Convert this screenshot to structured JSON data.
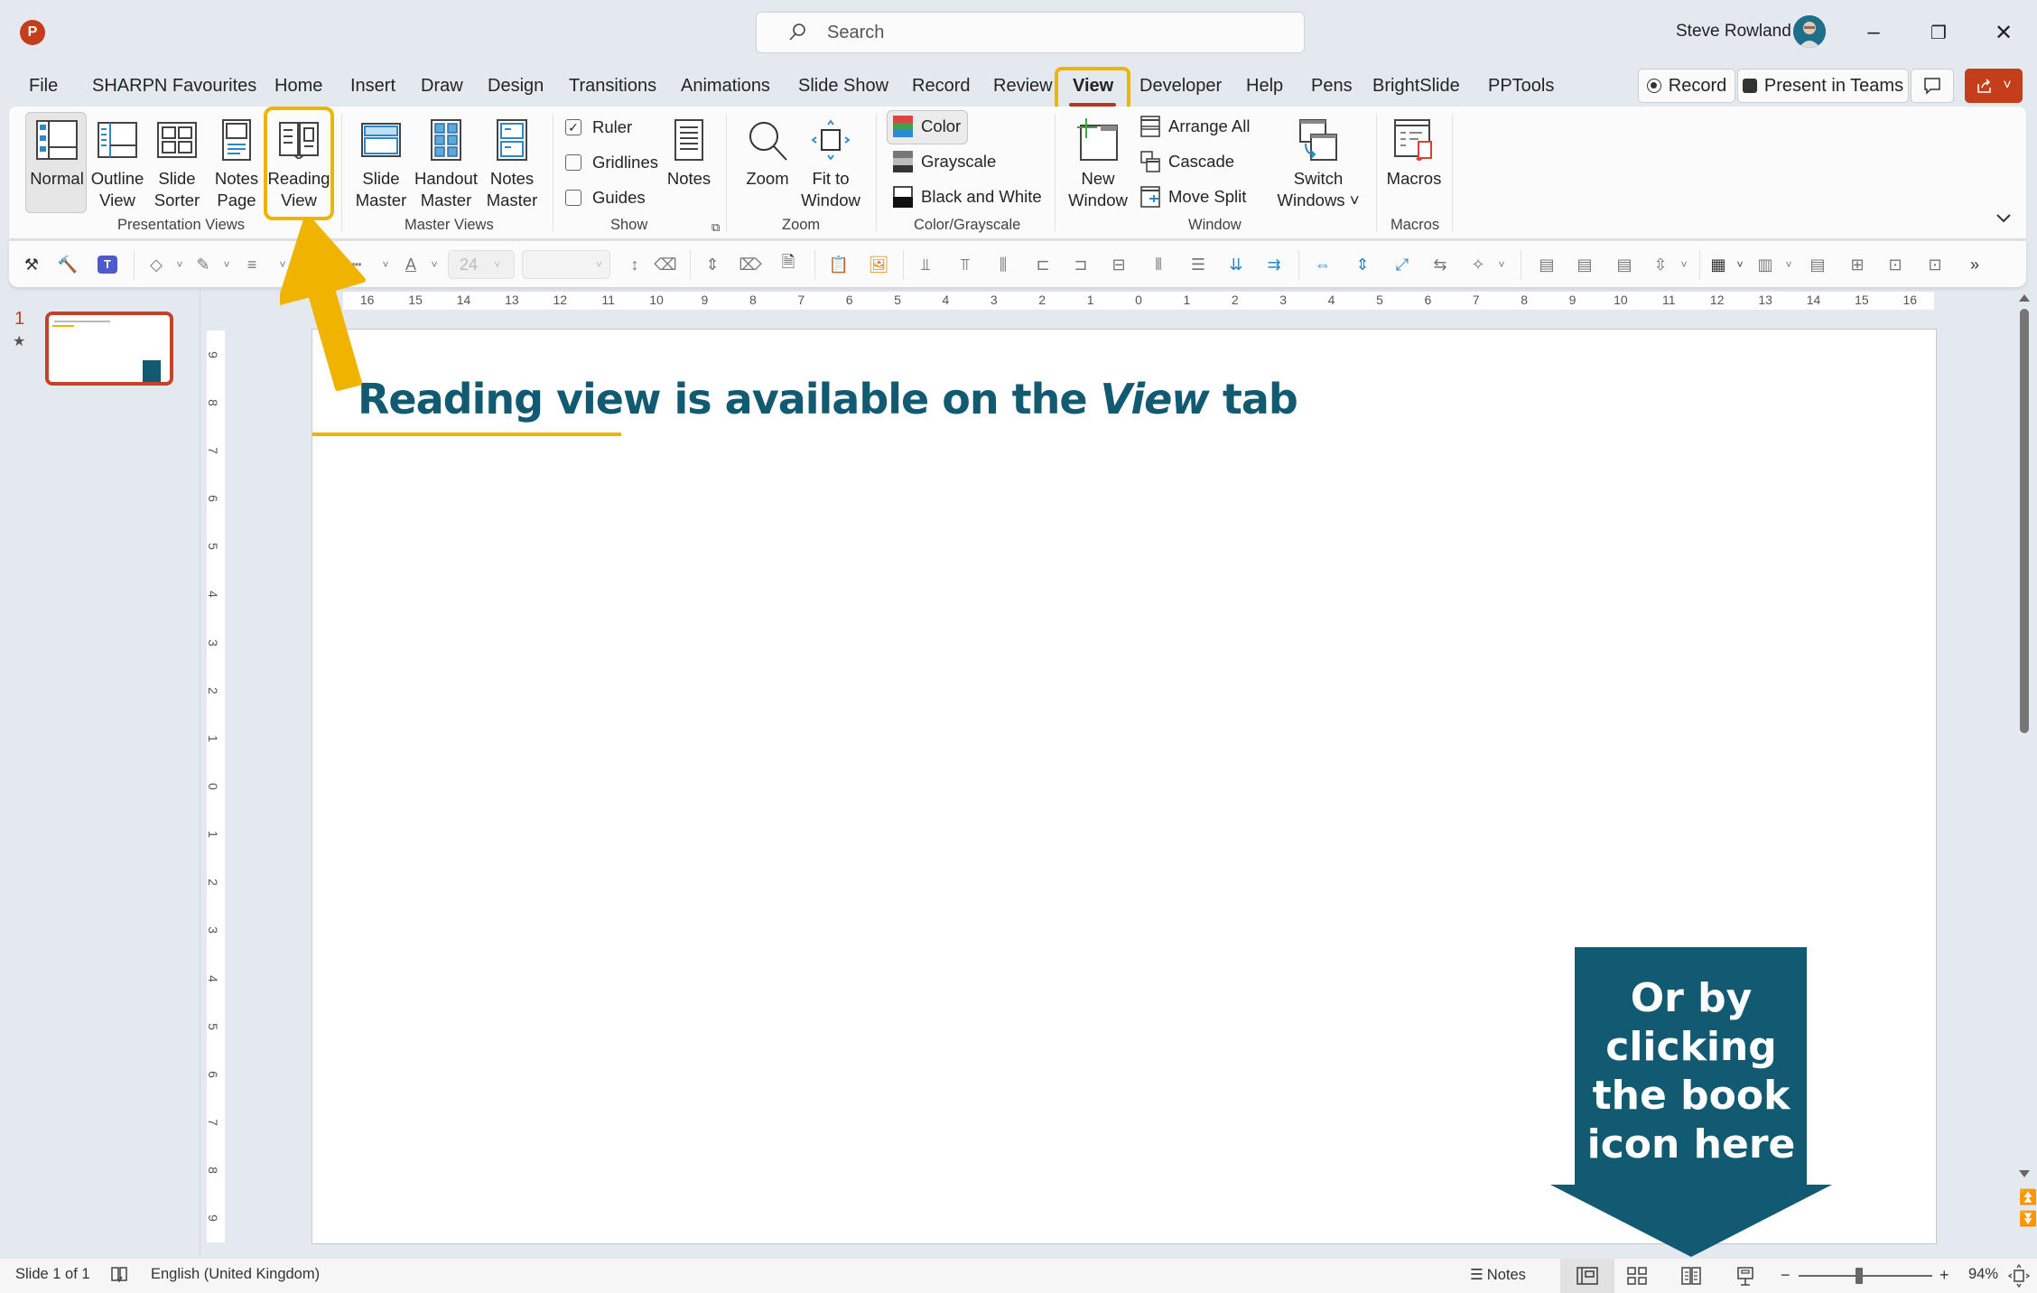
{
  "app": {
    "logo_letter": "P",
    "search_placeholder": "Search",
    "user_name": "Steve Rowland",
    "window_controls": {
      "minimize": "–",
      "restore": "❐",
      "close": "✕"
    }
  },
  "tabs": [
    {
      "label": "File"
    },
    {
      "label": "SHARPN Favourites"
    },
    {
      "label": "Home"
    },
    {
      "label": "Insert"
    },
    {
      "label": "Draw"
    },
    {
      "label": "Design"
    },
    {
      "label": "Transitions"
    },
    {
      "label": "Animations"
    },
    {
      "label": "Slide Show"
    },
    {
      "label": "Record"
    },
    {
      "label": "Review"
    },
    {
      "label": "View",
      "active": true
    },
    {
      "label": "Developer"
    },
    {
      "label": "Help"
    },
    {
      "label": "Pens"
    },
    {
      "label": "BrightSlide"
    },
    {
      "label": "PPTools"
    }
  ],
  "top_buttons": {
    "record": "Record",
    "present_in_teams": "Present in Teams"
  },
  "ribbon": {
    "presentation_views": {
      "label": "Presentation Views",
      "buttons": [
        {
          "l1": "Normal",
          "l2": "",
          "selected": true
        },
        {
          "l1": "Outline",
          "l2": "View"
        },
        {
          "l1": "Slide",
          "l2": "Sorter"
        },
        {
          "l1": "Notes",
          "l2": "Page"
        },
        {
          "l1": "Reading",
          "l2": "View",
          "highlighted": true
        }
      ]
    },
    "master_views": {
      "label": "Master Views",
      "buttons": [
        {
          "l1": "Slide",
          "l2": "Master"
        },
        {
          "l1": "Handout",
          "l2": "Master"
        },
        {
          "l1": "Notes",
          "l2": "Master"
        }
      ]
    },
    "show": {
      "label": "Show",
      "checkboxes": [
        {
          "label": "Ruler",
          "checked": true
        },
        {
          "label": "Gridlines",
          "checked": false
        },
        {
          "label": "Guides",
          "checked": false
        }
      ],
      "notes_label": "Notes"
    },
    "zoom": {
      "label": "Zoom",
      "buttons": [
        {
          "l1": "Zoom",
          "l2": ""
        },
        {
          "l1": "Fit to",
          "l2": "Window"
        }
      ]
    },
    "color_grayscale": {
      "label": "Color/Grayscale",
      "items": [
        {
          "label": "Color",
          "selected": true
        },
        {
          "label": "Grayscale"
        },
        {
          "label": "Black and White"
        }
      ]
    },
    "window": {
      "label": "Window",
      "new_window": {
        "l1": "New",
        "l2": "Window"
      },
      "items": [
        {
          "label": "Arrange All"
        },
        {
          "label": "Cascade"
        },
        {
          "label": "Move Split"
        }
      ],
      "switch_windows": {
        "l1": "Switch",
        "l2": "Windows ˅"
      }
    },
    "macros": {
      "label": "Macros",
      "button": "Macros"
    }
  },
  "qat": {
    "font_size": "24",
    "font_name": "",
    "overflow": "»"
  },
  "thumbnails": [
    {
      "number": "1",
      "has_animation": true
    }
  ],
  "rulers": {
    "horizontal": [
      "16",
      "15",
      "14",
      "13",
      "12",
      "11",
      "10",
      "9",
      "8",
      "7",
      "6",
      "5",
      "4",
      "3",
      "2",
      "1",
      "0",
      "1",
      "2",
      "3",
      "4",
      "5",
      "6",
      "7",
      "8",
      "9",
      "10",
      "11",
      "12",
      "13",
      "14",
      "15",
      "16"
    ],
    "vertical": [
      "9",
      "8",
      "7",
      "6",
      "5",
      "4",
      "3",
      "2",
      "1",
      "0",
      "1",
      "2",
      "3",
      "4",
      "5",
      "6",
      "7",
      "8",
      "9"
    ]
  },
  "slide": {
    "title_part1": "Reading view is available on the ",
    "title_italic": "View",
    "title_part2": " tab",
    "callout_lines": [
      "Or by",
      "clicking",
      "the book",
      "icon here"
    ],
    "colors": {
      "title": "#125a71",
      "accent": "#f0b400",
      "callout": "#125a71"
    }
  },
  "status": {
    "slide_count": "Slide 1 of 1",
    "language": "English (United Kingdom)",
    "notes": "Notes",
    "zoom_percent": "94%",
    "zoom_level": 0.45
  },
  "colors": {
    "brand": "#c43e1c",
    "highlight": "#f0b400",
    "active_tab_underline": "#b4371f"
  }
}
